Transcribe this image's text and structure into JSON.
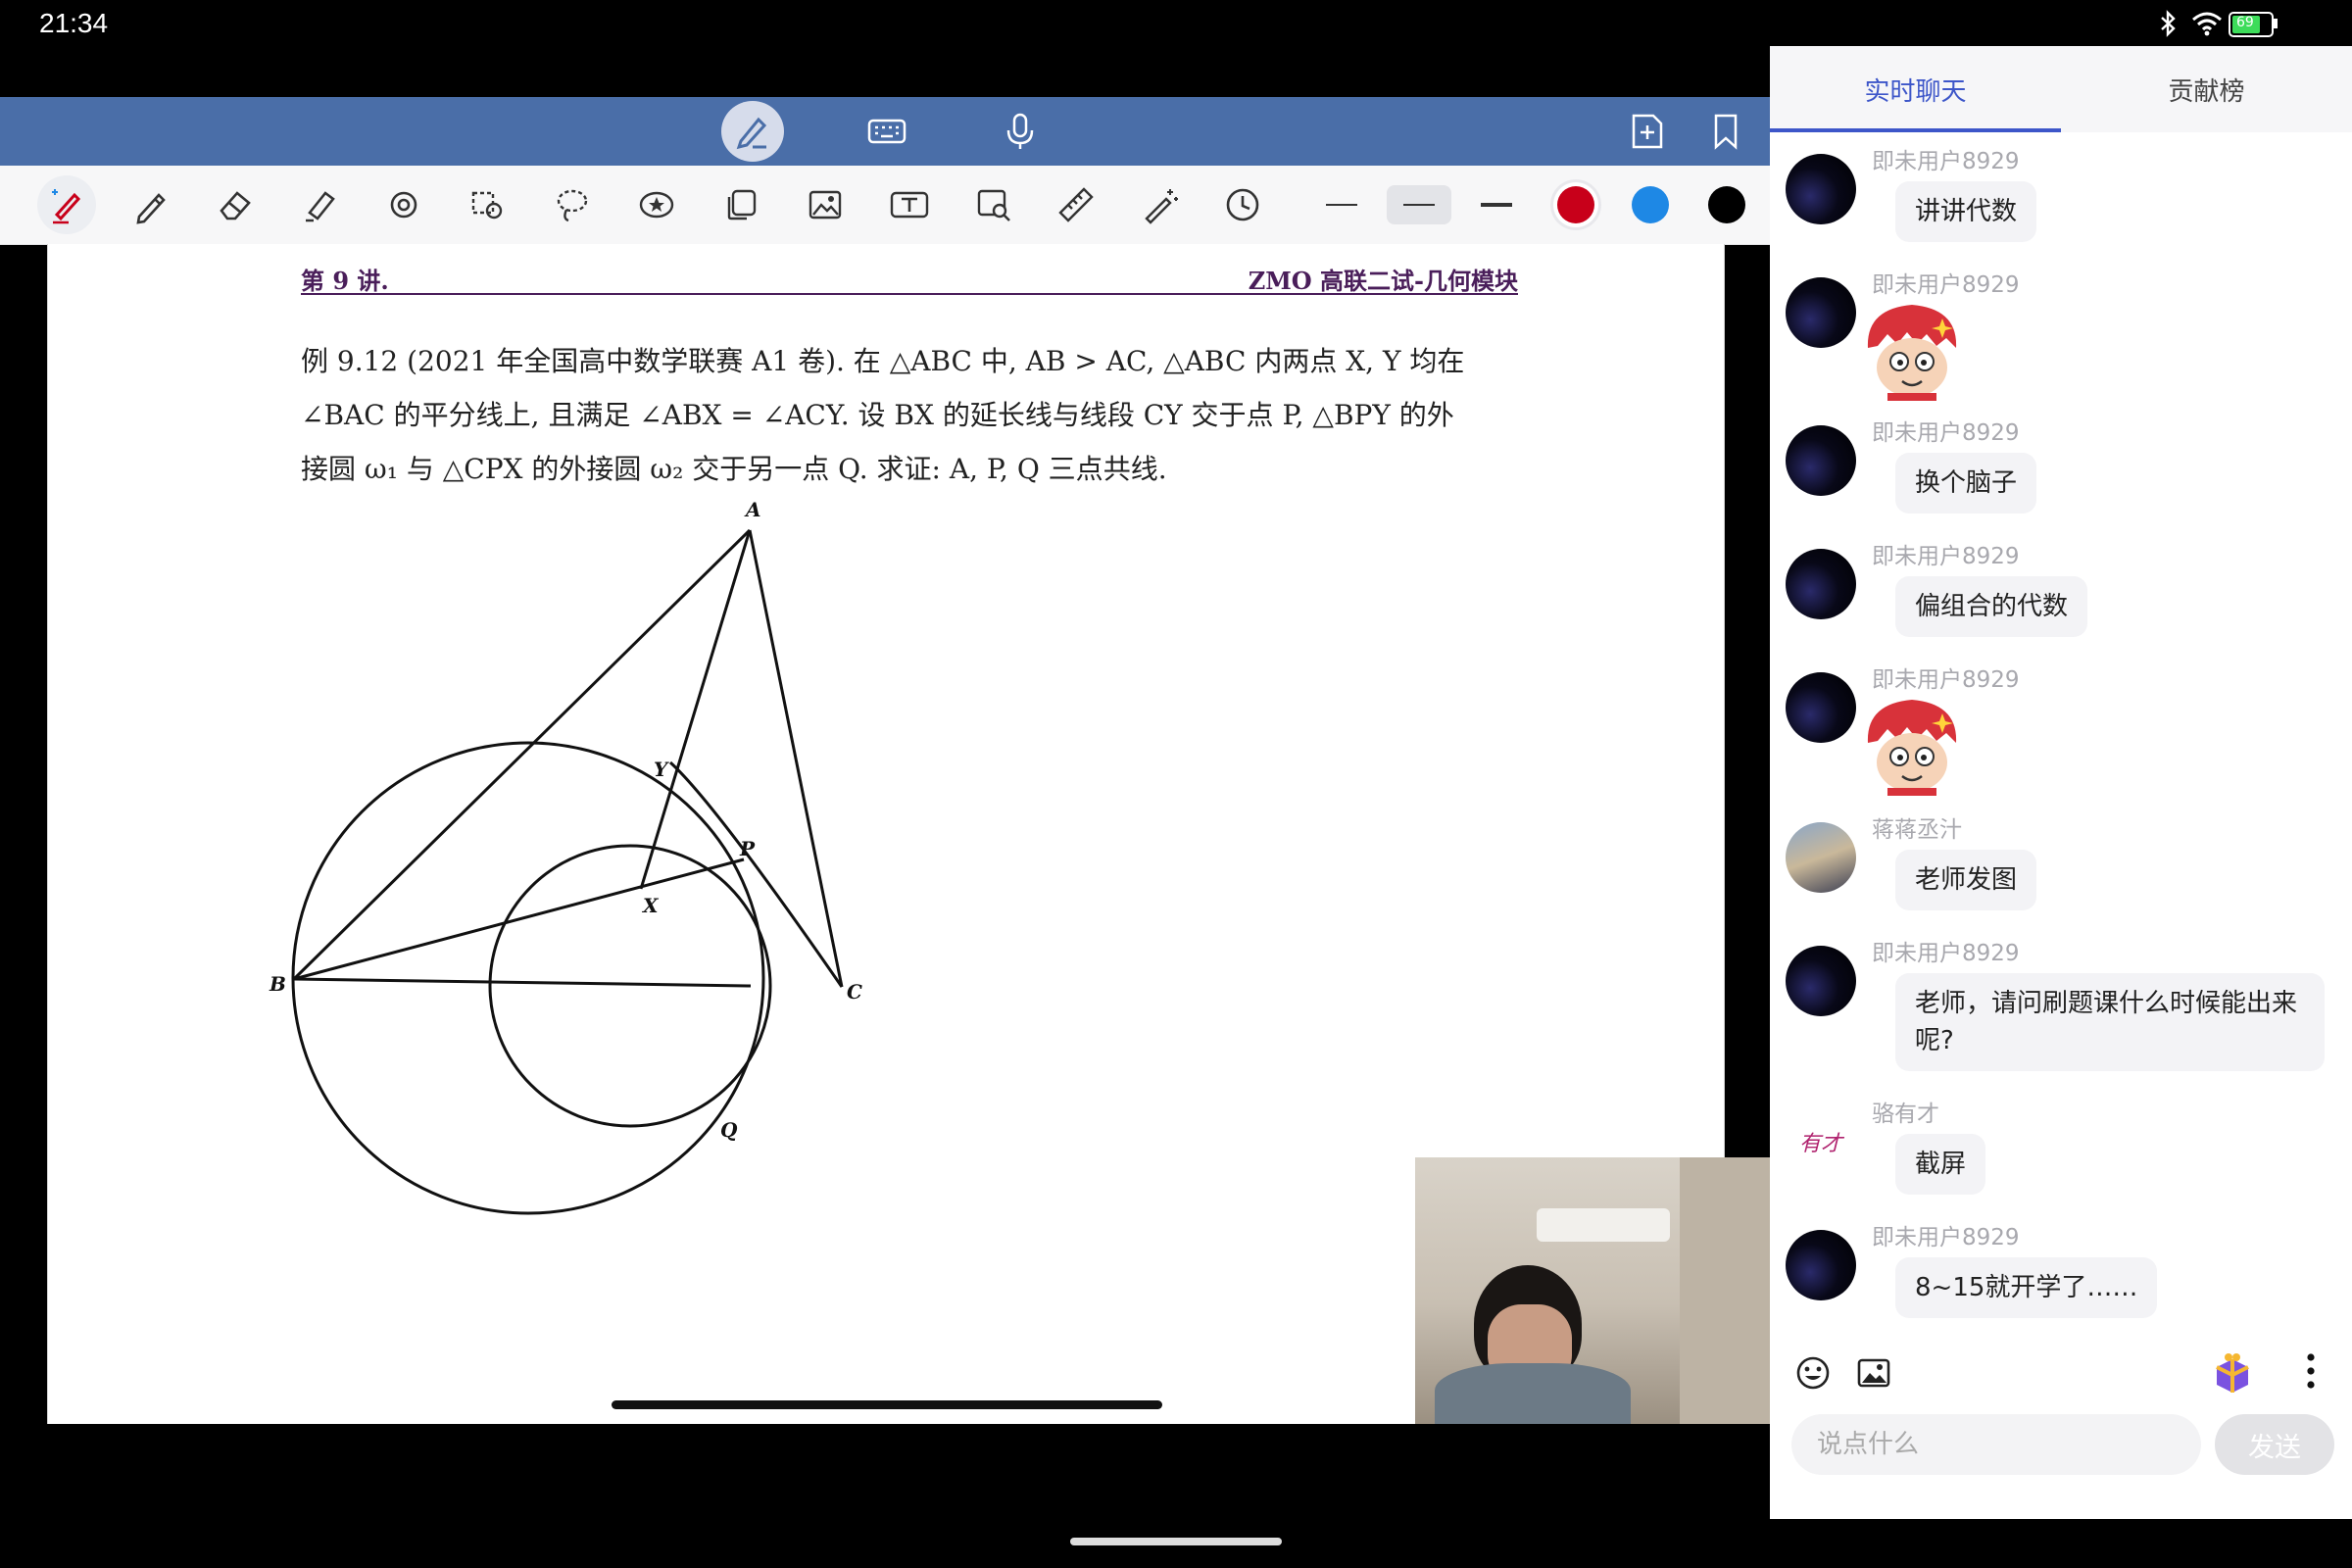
{
  "status_bar": {
    "time": "21:34",
    "battery": "69"
  },
  "page": {
    "header_left": "第 9 讲.",
    "header_right": "ZMO 高联二试-几何模块",
    "problem_lines": [
      "例 9.12 (2021 年全国高中数学联赛 A1 卷). 在 △ABC 中, AB > AC, △ABC 内两点 X, Y 均在",
      "∠BAC 的平分线上, 且满足 ∠ABX = ∠ACY. 设 BX 的延长线与线段 CY 交于点 P, △BPY 的外",
      "接圆 ω₁ 与 △CPX 的外接圆 ω₂ 交于另一点 Q. 求证: A, P, Q 三点共线."
    ],
    "figure_labels": {
      "A": "A",
      "B": "B",
      "C": "C",
      "X": "X",
      "Y": "Y",
      "P": "P",
      "Q": "Q"
    }
  },
  "colors": {
    "topbar": "#4a6ea8",
    "tab_active": "#3d56c9",
    "red": "#c8001a",
    "blue": "#1e88e5",
    "black": "#000000"
  },
  "chat": {
    "tabs": [
      "实时聊天",
      "贡献榜"
    ],
    "messages": [
      {
        "user": "即未用户8929",
        "text": "讲讲代数"
      },
      {
        "user": "即未用户8929",
        "sticker": "cartoon-face-sticker"
      },
      {
        "user": "即未用户8929",
        "text": "换个脑子"
      },
      {
        "user": "即未用户8929",
        "text": "偏组合的代数"
      },
      {
        "user": "即未用户8929",
        "sticker": "cartoon-face-sticker"
      },
      {
        "user": "蒋蒋丞汁",
        "text": "老师发图"
      },
      {
        "user": "即未用户8929",
        "text": "老师，请问刷题课什么时候能出来呢?"
      },
      {
        "user": "骆有才",
        "avatar_text": "有才",
        "text": "截屏"
      },
      {
        "user": "即未用户8929",
        "text": "8~15就开学了……"
      }
    ],
    "input_placeholder": "说点什么",
    "send_label": "发送"
  }
}
